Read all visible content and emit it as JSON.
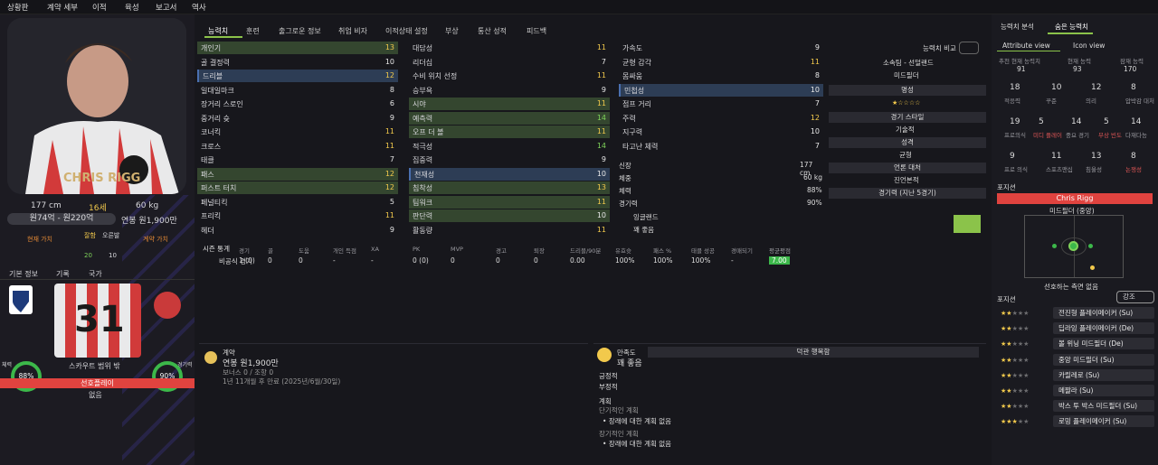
{
  "nav": [
    "상황판",
    "계약 세부",
    "이적",
    "육성",
    "보고서",
    "역사"
  ],
  "player": {
    "name": "CHRIS RIGG",
    "height": "177 cm",
    "age": "16세",
    "weight": "60 kg",
    "value_range": "원74억 - 원220억",
    "wage": "연봉 원1,900만",
    "current_label": "현재 가치",
    "wage_label": "계약 가치",
    "stat_left_label": "잘함",
    "stat_right_label": "오른발",
    "stat_left": "20",
    "stat_right": "10",
    "shirt_number": "31",
    "shirt_name": "스카우트 범위 밖",
    "tabs": [
      "기본 정보",
      "기록",
      "국가"
    ],
    "left_circle": "88%",
    "right_circle": "90%",
    "left_circle_label": "체력",
    "right_circle_label": "경기력",
    "selection_label": "선호플레이",
    "selection_value": "없음"
  },
  "main_tabs": [
    "능력치",
    "훈련",
    "출그로운 정보",
    "취업 비자",
    "이적상태 설정",
    "부상",
    "통산 성적",
    "피드백"
  ],
  "technical": [
    [
      "개인기",
      "13"
    ],
    [
      "골 결정력",
      "10"
    ],
    [
      "드리블",
      "12"
    ],
    [
      "일대일마크",
      "8"
    ],
    [
      "장거리 스로인",
      "6"
    ],
    [
      "중거리 슛",
      "9"
    ],
    [
      "코너킥",
      "11"
    ],
    [
      "크로스",
      "11"
    ],
    [
      "태클",
      "7"
    ],
    [
      "패스",
      "12"
    ],
    [
      "퍼스트 터치",
      "12"
    ],
    [
      "페널티킥",
      "5"
    ],
    [
      "프리킥",
      "11"
    ],
    [
      "헤더",
      "9"
    ]
  ],
  "mental": [
    [
      "대담성",
      "11"
    ],
    [
      "리더십",
      "7"
    ],
    [
      "수비 위치 선정",
      "11"
    ],
    [
      "승부욕",
      "9"
    ],
    [
      "시야",
      "11"
    ],
    [
      "예측력",
      "14"
    ],
    [
      "오프 더 볼",
      "11"
    ],
    [
      "적극성",
      "14"
    ],
    [
      "집중력",
      "9"
    ],
    [
      "천재성",
      "10"
    ],
    [
      "침착성",
      "13"
    ],
    [
      "팀워크",
      "11"
    ],
    [
      "판단력",
      "10"
    ],
    [
      "활동량",
      "11"
    ]
  ],
  "physical": [
    [
      "가속도",
      "9"
    ],
    [
      "균형 감각",
      "11"
    ],
    [
      "몸싸움",
      "8"
    ],
    [
      "민첩성",
      "10"
    ],
    [
      "점프 거리",
      "7"
    ],
    [
      "주력",
      "12"
    ],
    [
      "지구력",
      "10"
    ],
    [
      "타고난 체력",
      "7"
    ]
  ],
  "info": {
    "height_l": "신장",
    "height_v": "177 cm",
    "weight_l": "체중",
    "weight_v": "60 kg",
    "fit_l": "체력",
    "fit_v": "88%",
    "match_l": "경기력",
    "match_v": "90%",
    "nation": "잉글랜드",
    "condition": "꽤 좋음"
  },
  "compare": {
    "btn": "능력치 비교",
    "club": "소속팀 - 선덜랜드",
    "position": "미드필더",
    "rep_label": "명성",
    "style_label": "경기 스타일",
    "style_value": "기술적",
    "personality_label": "성격",
    "personality_value": "균형",
    "media_label": "언론 대처",
    "media_value": "진언본적",
    "form_label": "경기력 (지난 5경기)"
  },
  "season": {
    "title": "시즌 통계",
    "headers": [
      "경기",
      "골",
      "도움",
      "개인 득점",
      "XA",
      "PK",
      "MVP",
      "경고",
      "퇴장",
      "드리블/90분",
      "유효슛",
      "패스 %",
      "태클 성공",
      "경매되기",
      "평균평점"
    ],
    "label": "비공식 경기",
    "values": [
      "1 (0)",
      "0",
      "0",
      "-",
      "-",
      "0 (0)",
      "0",
      "0",
      "0",
      "0.00",
      "100%",
      "100%",
      "100%",
      "-",
      "7.00"
    ]
  },
  "contract": {
    "title": "계약",
    "wage": "연봉 원1,900만",
    "bonus": "보너스 0 / 조항 0",
    "expiry": "1년 11개월 후 만료 (2025년/6월/30일)"
  },
  "happy": {
    "title": "만족도",
    "value": "꽤 좋음",
    "header": "덕관 행복함",
    "pos": "긍정적",
    "neg": "부정적",
    "plans": "계획",
    "short": "단기적인 계획",
    "short_item": "장래에 대한 계획 없음",
    "long": "장기적인 계획",
    "long_item": "장래에 대한 계획 없음"
  },
  "right": {
    "tabs": [
      "능력치 분석",
      "숨은 능력치"
    ],
    "subtabs": [
      "Attribute view",
      "Icon view"
    ],
    "top": [
      [
        "추천 현재 능력치",
        "91"
      ],
      [
        "현재 능력",
        "93"
      ],
      [
        "잠재 능력",
        "170"
      ]
    ],
    "grid": [
      [
        "18",
        "적응력",
        "g"
      ],
      [
        "10",
        "꾸준",
        "w"
      ],
      [
        "12",
        "의리",
        "y"
      ],
      [
        "8",
        "압박감 대처",
        "w"
      ],
      [
        "19",
        "프로의식",
        "g"
      ],
      [
        "5",
        "미디 플레이",
        "red"
      ],
      [
        "14",
        "중요 경기",
        "y"
      ],
      [
        "5",
        "부상 빈도",
        "red"
      ],
      [
        "14",
        "다재다능",
        "y"
      ],
      [
        "9",
        "프로 의식",
        "w"
      ],
      [
        "11",
        "스포츠맨십",
        "y"
      ],
      [
        "13",
        "침울성",
        "y"
      ],
      [
        "8",
        "논쟁성",
        "red"
      ]
    ],
    "pos_title": "포지션",
    "pos_name": "Chris Rigg",
    "pos_sub": "미드필더 (중앙)",
    "pos_foot": "선호하는 측면 없음",
    "roles_title": "포지션",
    "roles_btn": "강조",
    "roles": [
      [
        "2",
        "전진형 플레이메이커 (Su)"
      ],
      [
        "2",
        "딥라잉 플레이메이커 (De)"
      ],
      [
        "2",
        "볼 위닝 미드필더 (De)"
      ],
      [
        "2",
        "중앙 미드필더 (Su)"
      ],
      [
        "2",
        "카릴레로 (Su)"
      ],
      [
        "2",
        "메짤라 (Su)"
      ],
      [
        "2",
        "박스 투 박스 미드필더 (Su)"
      ],
      [
        "3",
        "로밍 플레이메이커 (Su)"
      ]
    ]
  },
  "colors": {
    "accent": "#e0433f",
    "good": "#7fd35a",
    "hl": "#34462f"
  }
}
